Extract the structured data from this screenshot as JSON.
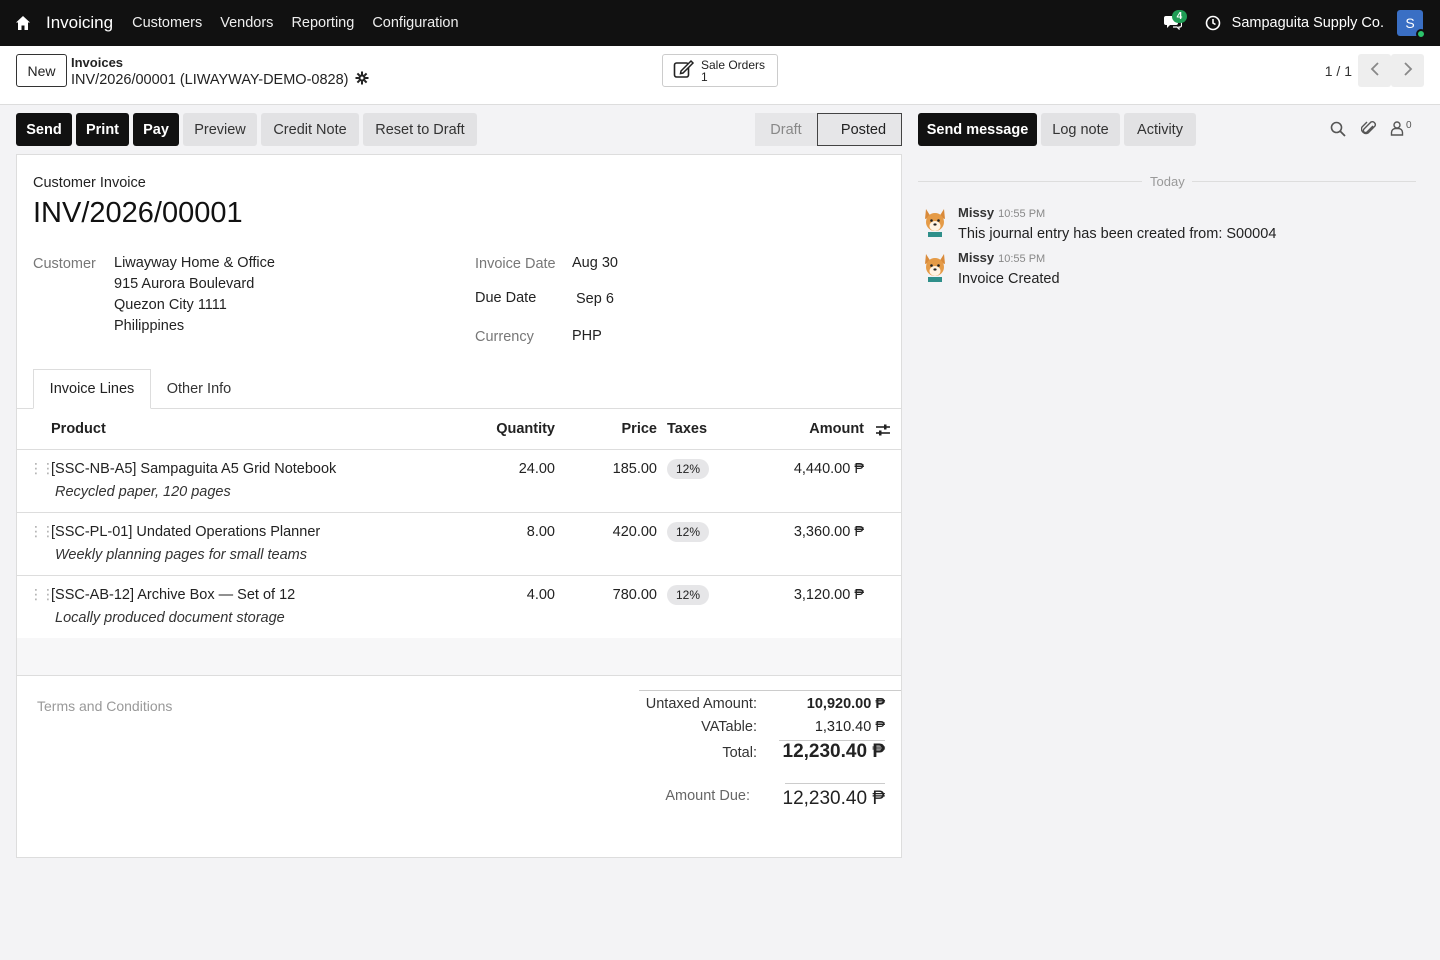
{
  "navbar": {
    "app_name": "Invoicing",
    "menus": [
      "Customers",
      "Vendors",
      "Reporting",
      "Configuration"
    ],
    "chat_count": "4",
    "company": "Sampaguita Supply Co.",
    "user_initial": "S"
  },
  "control": {
    "new_label": "New",
    "breadcrumb_parent": "Invoices",
    "breadcrumb_current": "INV/2026/00001 (LIWAYWAY-DEMO-0828)",
    "smart_button_label": "Sale Orders",
    "smart_button_count": "1",
    "pager": "1 / 1"
  },
  "actions": {
    "send": "Send",
    "print": "Print",
    "pay": "Pay",
    "preview": "Preview",
    "credit_note": "Credit Note",
    "reset_to_draft": "Reset to Draft"
  },
  "statusbar": {
    "draft": "Draft",
    "posted": "Posted",
    "current": "Posted"
  },
  "invoice": {
    "type_label": "Customer Invoice",
    "name": "INV/2026/00001",
    "customer_label": "Customer",
    "customer_name": "Liwayway Home & Office",
    "customer_address": [
      "915 Aurora Boulevard",
      "Quezon City 1111",
      "Philippines"
    ],
    "invoice_date_label": "Invoice Date",
    "invoice_date": "Aug 30",
    "due_date_label": "Due Date",
    "due_date": "Sep 6",
    "currency_label": "Currency",
    "currency": "PHP"
  },
  "tabs": [
    "Invoice Lines",
    "Other Info"
  ],
  "lines_table": {
    "headers": {
      "product": "Product",
      "quantity": "Quantity",
      "price": "Price",
      "taxes": "Taxes",
      "amount": "Amount"
    },
    "rows": [
      {
        "product": "[SSC-NB-A5] Sampaguita A5 Grid Notebook",
        "description": "Recycled paper, 120 pages",
        "quantity": "24.00",
        "price": "185.00",
        "tax": "12%",
        "amount": "4,440.00 ₱"
      },
      {
        "product": "[SSC-PL-01] Undated Operations Planner",
        "description": "Weekly planning pages for small teams",
        "quantity": "8.00",
        "price": "420.00",
        "tax": "12%",
        "amount": "3,360.00 ₱"
      },
      {
        "product": "[SSC-AB-12] Archive Box — Set of 12",
        "description": "Locally produced document storage",
        "quantity": "4.00",
        "price": "780.00",
        "tax": "12%",
        "amount": "3,120.00 ₱"
      }
    ]
  },
  "terms_placeholder": "Terms and Conditions",
  "totals": {
    "untaxed_label": "Untaxed Amount:",
    "untaxed_value": "10,920.00 ₱",
    "vatable_label": "VATable:",
    "vatable_value": "1,310.40 ₱",
    "total_label": "Total:",
    "total_value": "12,230.40 ₱",
    "amount_due_label": "Amount Due:",
    "amount_due_value": "12,230.40 ₱"
  },
  "chatter": {
    "send_message": "Send message",
    "log_note": "Log note",
    "activity": "Activity",
    "followers_count": "0",
    "date_separator": "Today",
    "messages": [
      {
        "author": "Missy",
        "time": "10:55 PM",
        "body": "This journal entry has been created from: S00004"
      },
      {
        "author": "Missy",
        "time": "10:55 PM",
        "body": "Invoice Created"
      }
    ]
  },
  "colors": {
    "navbar_bg": "#111111",
    "primary_button": "#111111",
    "badge": "#1f9d55",
    "avatar": "#3a6fc4"
  }
}
